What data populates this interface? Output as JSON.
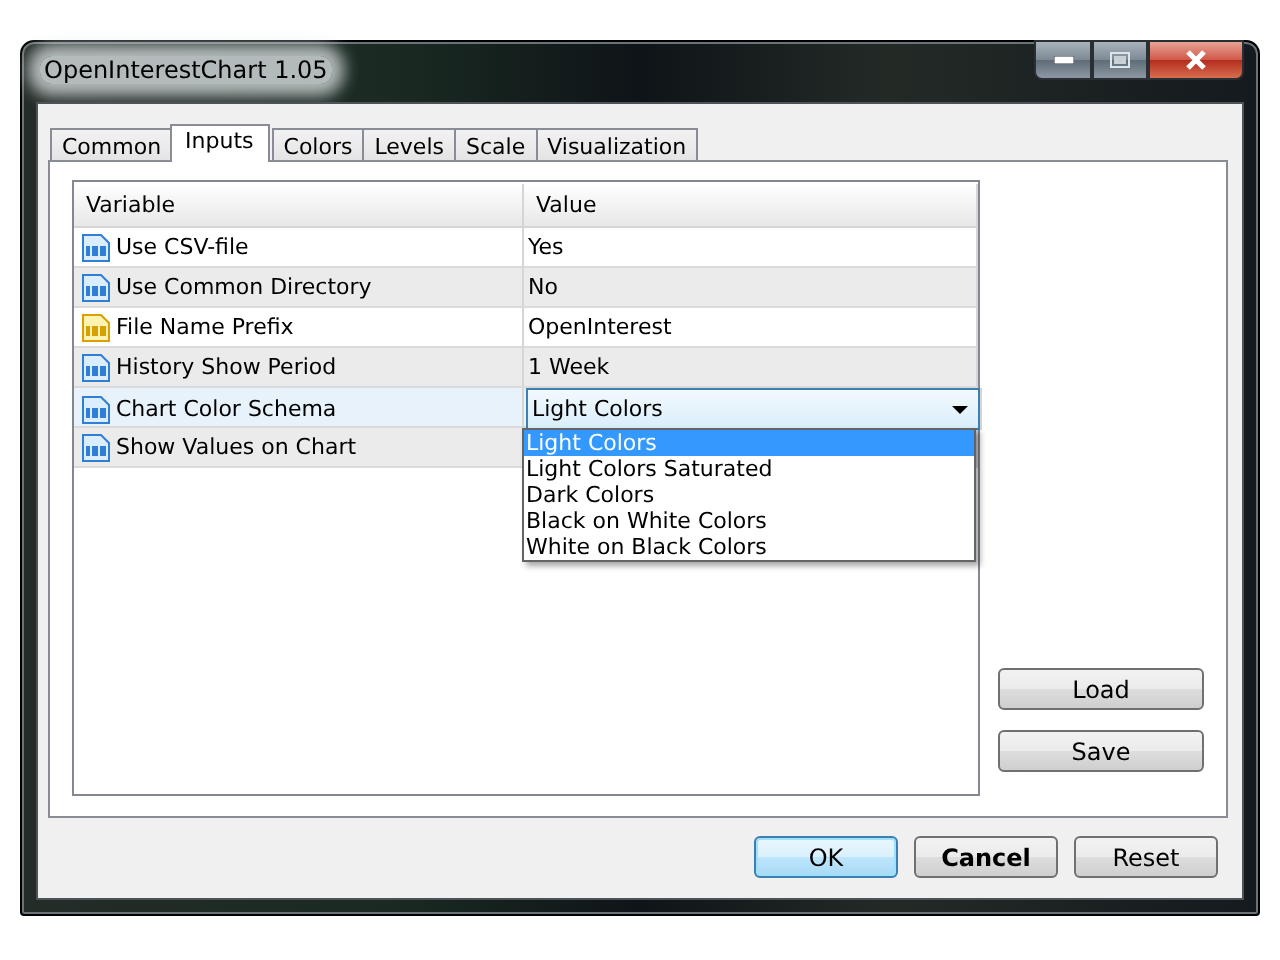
{
  "window": {
    "title": "OpenInterestChart 1.05"
  },
  "tabs": [
    {
      "label": "Common",
      "selected": false
    },
    {
      "label": "Inputs",
      "selected": true
    },
    {
      "label": "Colors",
      "selected": false
    },
    {
      "label": "Levels",
      "selected": false
    },
    {
      "label": "Scale",
      "selected": false
    },
    {
      "label": "Visualization",
      "selected": false
    }
  ],
  "table": {
    "columns": [
      "Variable",
      "Value"
    ],
    "rows": [
      {
        "kind": "number",
        "name": "Use CSV-file",
        "value": "Yes",
        "expanded": false,
        "selected": false
      },
      {
        "kind": "number",
        "name": "Use Common Directory",
        "value": "No",
        "expanded": false,
        "selected": false
      },
      {
        "kind": "string",
        "name": "File Name Prefix",
        "value": "OpenInterest",
        "expanded": false,
        "selected": false
      },
      {
        "kind": "number",
        "name": "History Show Period",
        "value": "1 Week",
        "expanded": false,
        "selected": false
      },
      {
        "kind": "number",
        "name": "Chart Color Schema",
        "value": "Light Colors",
        "expanded": true,
        "selected": true
      },
      {
        "kind": "number",
        "name": "Show Values on Chart",
        "expanded": false,
        "selected": false
      }
    ]
  },
  "dropdown_list": [
    {
      "label": "Light Colors",
      "selected": true
    },
    {
      "label": "Light Colors Saturated",
      "selected": false
    },
    {
      "label": "Dark Colors",
      "selected": false
    },
    {
      "label": "Black on White Colors",
      "selected": false
    },
    {
      "label": "White on Black Colors",
      "selected": false
    }
  ],
  "side_buttons": [
    "Load",
    "Save"
  ],
  "footer_buttons": [
    {
      "label": "OK",
      "kind": "default"
    },
    {
      "label": "Cancel",
      "kind": "bold"
    },
    {
      "label": "Reset",
      "kind": "normal"
    }
  ]
}
